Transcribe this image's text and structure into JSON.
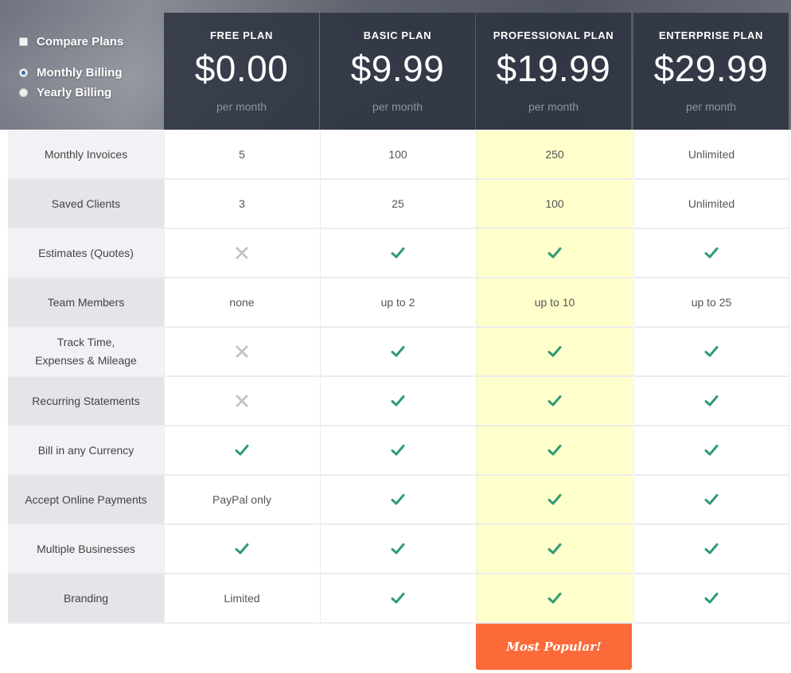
{
  "controls": {
    "compare_label": "Compare Plans",
    "monthly_label": "Monthly Billing",
    "yearly_label": "Yearly Billing",
    "selected_billing": "Monthly Billing"
  },
  "plans": [
    {
      "name": "FREE PLAN",
      "price": "$0.00",
      "period": "per month"
    },
    {
      "name": "BASIC PLAN",
      "price": "$9.99",
      "period": "per month"
    },
    {
      "name": "PROFESSIONAL PLAN",
      "price": "$19.99",
      "period": "per month"
    },
    {
      "name": "ENTERPRISE PLAN",
      "price": "$29.99",
      "period": "per month"
    }
  ],
  "features": [
    {
      "label": "Monthly Invoices",
      "values": [
        "5",
        "100",
        "250",
        "Unlimited"
      ]
    },
    {
      "label": "Saved Clients",
      "values": [
        "3",
        "25",
        "100",
        "Unlimited"
      ]
    },
    {
      "label": "Estimates (Quotes)",
      "values": [
        "cross",
        "check",
        "check",
        "check"
      ]
    },
    {
      "label": "Team Members",
      "values": [
        "none",
        "up to 2",
        "up to 10",
        "up to 25"
      ]
    },
    {
      "label": "Track Time, Expenses & Mileage",
      "values": [
        "cross",
        "check",
        "check",
        "check"
      ]
    },
    {
      "label": "Recurring Statements",
      "values": [
        "cross",
        "check",
        "check",
        "check"
      ]
    },
    {
      "label": "Bill in any Currency",
      "values": [
        "check",
        "check",
        "check",
        "check"
      ]
    },
    {
      "label": "Accept Online Payments",
      "values": [
        "PayPal only",
        "check",
        "check",
        "check"
      ]
    },
    {
      "label": "Multiple Businesses",
      "values": [
        "check",
        "check",
        "check",
        "check"
      ]
    },
    {
      "label": "Branding",
      "values": [
        "Limited",
        "check",
        "check",
        "check"
      ]
    }
  ],
  "badge": {
    "label": "Most Popular!"
  },
  "colors": {
    "check": "#2e9b76",
    "cross": "#c4c4c4",
    "highlight": "#ffffcc",
    "badge": "#fb6a38"
  },
  "icons": {
    "included": "check-icon",
    "excluded": "cross-icon"
  }
}
